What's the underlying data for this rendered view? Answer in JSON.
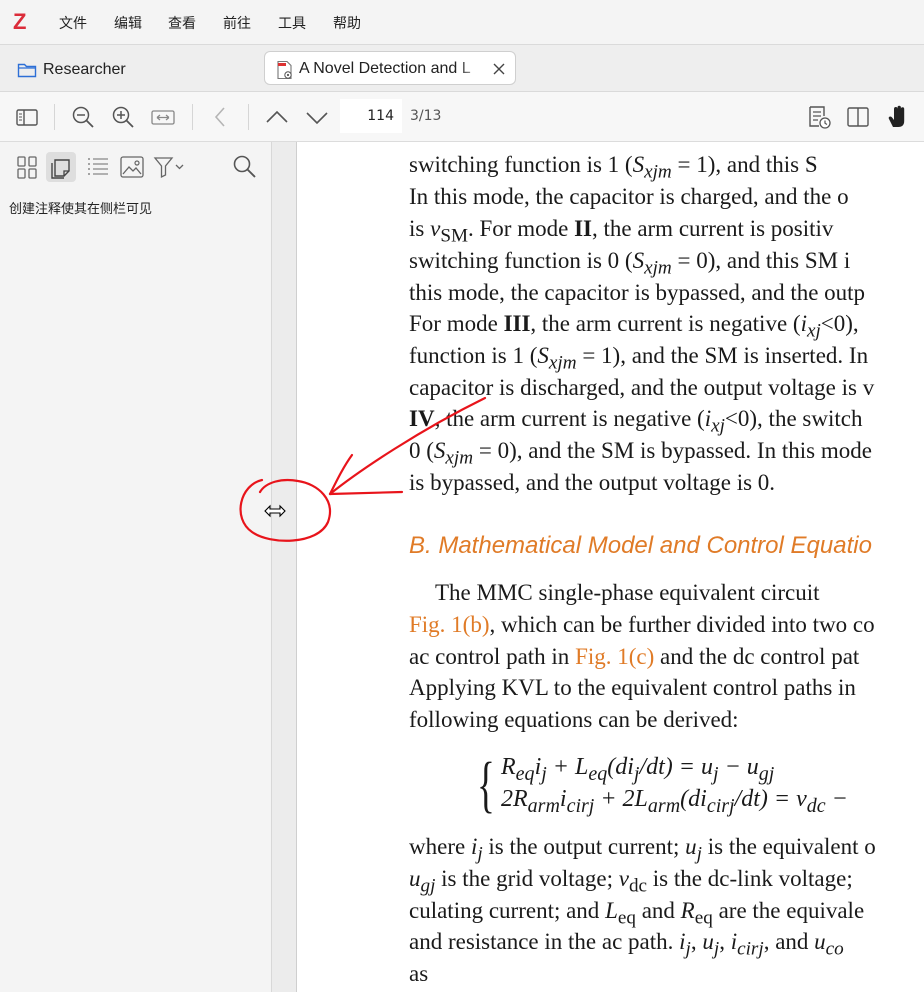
{
  "app": {
    "logo": "Z"
  },
  "menu": [
    "文件",
    "编辑",
    "查看",
    "前往",
    "工具",
    "帮助"
  ],
  "tabs": {
    "library": "Researcher",
    "document": "A Novel Detection and L"
  },
  "toolbar": {
    "page_value": "114",
    "page_count": "3/13"
  },
  "sidebar": {
    "hint": "创建注释使其在侧栏可见"
  },
  "document": {
    "lines": [
      "switching function is 1 (S_xjm = 1), and this S",
      "In this mode, the capacitor is charged, and the o",
      "is v_SM. For mode II, the arm current is positiv",
      "switching function is 0 (S_xjm = 0), and this SM i",
      "this mode, the capacitor is bypassed, and the outp",
      "For mode III, the arm current is negative (i_xj<0),",
      "function is 1 (S_xjm = 1), and the SM is inserted. In",
      "capacitor is discharged, and the output voltage is v",
      "IV, the arm current is negative (i_xj<0), the switch",
      "0 (S_xjm = 0), and the SM is bypassed. In this mode",
      "is bypassed, and the output voltage is 0."
    ],
    "section_heading": "B.  Mathematical Model and Control Equatio",
    "para2": [
      "The MMC single-phase equivalent circuit",
      "Fig. 1(b), which can be further divided into two co",
      "ac control path in Fig. 1(c) and the dc control pat",
      "Applying KVL to the equivalent control paths in",
      "following equations can be derived:"
    ],
    "equations": [
      "R_eq i_j + L_eq(di_j/dt) = u_j − u_gj",
      "2R_arm i_cirj + 2L_arm(di_cirj/dt) = v_dc −"
    ],
    "para3": [
      "where i_j is the output current; u_j is the equivalent o",
      "u_gj is the grid voltage; v_dc is the dc-link voltage;",
      "culating current; and L_eq and R_eq are the equivale",
      "and resistance in the ac path. i_j, u_j, i_cirj, and u_co",
      "as"
    ]
  },
  "colors": {
    "accent": "#e07b27",
    "logo": "#db2c3a",
    "annotation": "#e8141b"
  }
}
